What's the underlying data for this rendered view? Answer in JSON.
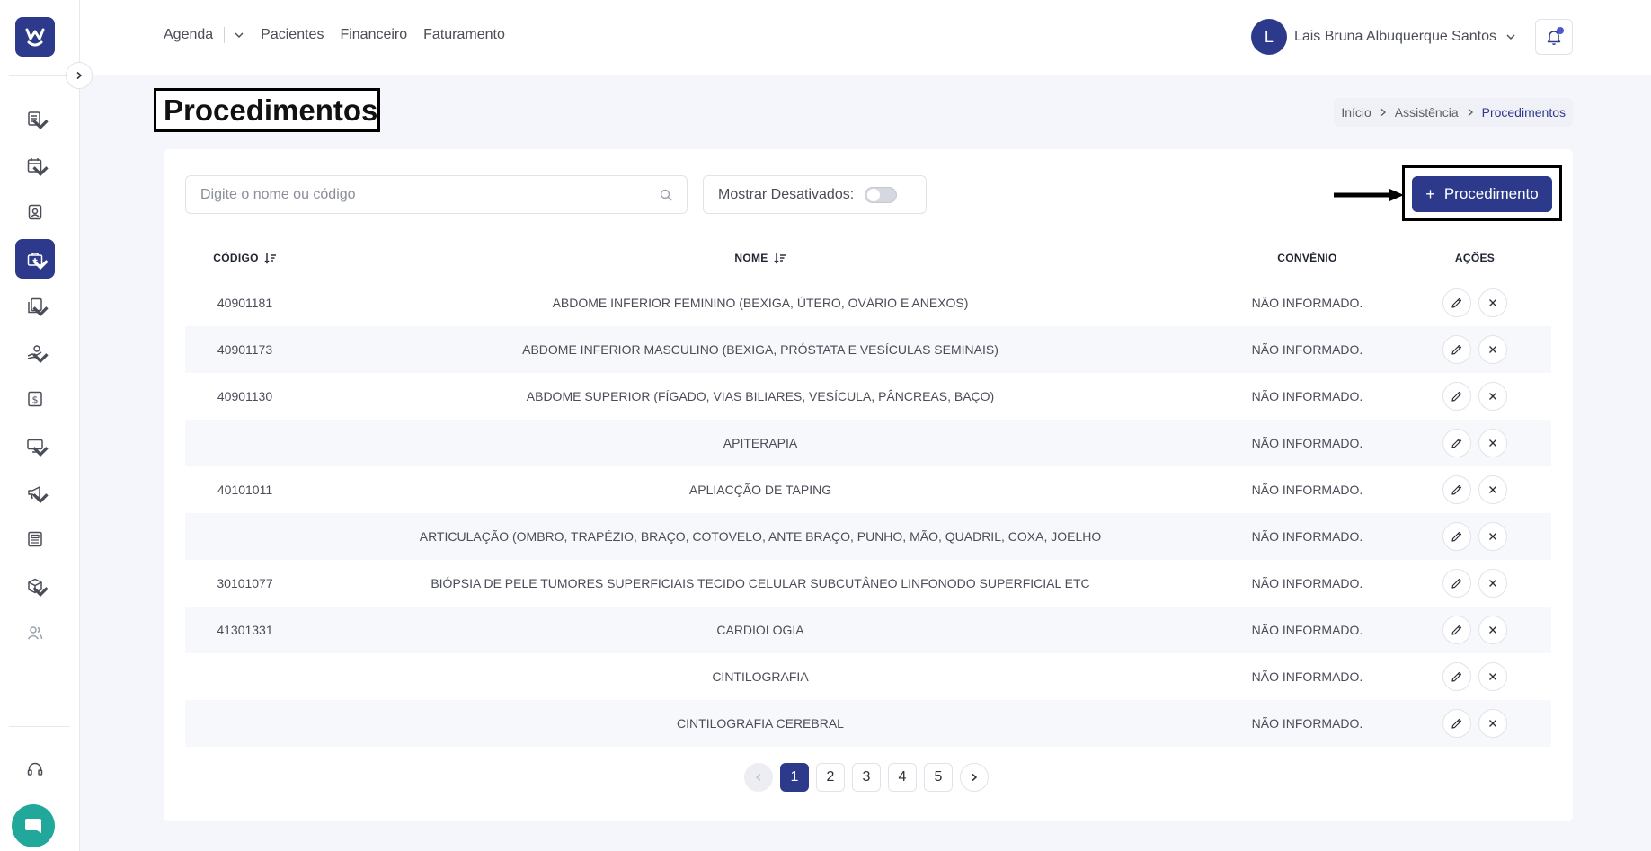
{
  "topnav": {
    "agenda": "Agenda",
    "pacientes": "Pacientes",
    "financeiro": "Financeiro",
    "faturamento": "Faturamento"
  },
  "user": {
    "initial": "L",
    "name": "Lais Bruna Albuquerque Santos"
  },
  "page": {
    "title": "Procedimentos"
  },
  "breadcrumb": {
    "home": "Início",
    "section": "Assistência",
    "current": "Procedimentos"
  },
  "filters": {
    "search_placeholder": "Digite o nome ou código",
    "show_disabled_label": "Mostrar Desativados:",
    "show_disabled": false
  },
  "actions": {
    "add_label": "Procedimento"
  },
  "table": {
    "headers": {
      "code": "CÓDIGO",
      "name": "NOME",
      "convenio": "CONVÊNIO",
      "actions": "AÇÕES"
    },
    "rows": [
      {
        "code": "40901181",
        "name": "ABDOME INFERIOR FEMININO (BEXIGA, ÚTERO, OVÁRIO E ANEXOS)",
        "convenio": "NÃO INFORMADO."
      },
      {
        "code": "40901173",
        "name": "ABDOME INFERIOR MASCULINO (BEXIGA, PRÓSTATA E VESÍCULAS SEMINAIS)",
        "convenio": "NÃO INFORMADO."
      },
      {
        "code": "40901130",
        "name": "ABDOME SUPERIOR (FÍGADO, VIAS BILIARES, VESÍCULA, PÂNCREAS, BAÇO)",
        "convenio": "NÃO INFORMADO."
      },
      {
        "code": "",
        "name": "APITERAPIA",
        "convenio": "NÃO INFORMADO."
      },
      {
        "code": "40101011",
        "name": "APLIACÇÃO DE TAPING",
        "convenio": "NÃO INFORMADO."
      },
      {
        "code": "",
        "name": "ARTICULAÇÃO (OMBRO, TRAPÉZIO, BRAÇO, COTOVELO, ANTE BRAÇO, PUNHO, MÃO, QUADRIL, COXA, JOELHO",
        "convenio": "NÃO INFORMADO."
      },
      {
        "code": "30101077",
        "name": "BIÓPSIA DE PELE TUMORES SUPERFICIAIS TECIDO CELULAR SUBCUTÂNEO LINFONODO SUPERFICIAL ETC",
        "convenio": "NÃO INFORMADO."
      },
      {
        "code": "41301331",
        "name": "CARDIOLOGIA",
        "convenio": "NÃO INFORMADO."
      },
      {
        "code": "",
        "name": "CINTILOGRAFIA",
        "convenio": "NÃO INFORMADO."
      },
      {
        "code": "",
        "name": "CINTILOGRAFIA CEREBRAL",
        "convenio": "NÃO INFORMADO."
      }
    ]
  },
  "pagination": {
    "pages": [
      "1",
      "2",
      "3",
      "4",
      "5"
    ],
    "current": "1"
  },
  "colors": {
    "primary": "#2d3a8c",
    "chat": "#22a89a",
    "notification_dot": "#4b57d1"
  },
  "icons": {
    "sidebar": [
      "list-icon",
      "calendar-icon",
      "contact-icon",
      "briefcase-medical-icon",
      "documents-icon",
      "hand-money-icon",
      "dollar-icon",
      "monitor-icon",
      "megaphone-icon",
      "newspaper-icon",
      "box-icon",
      "users-icon",
      "headset-icon"
    ]
  }
}
